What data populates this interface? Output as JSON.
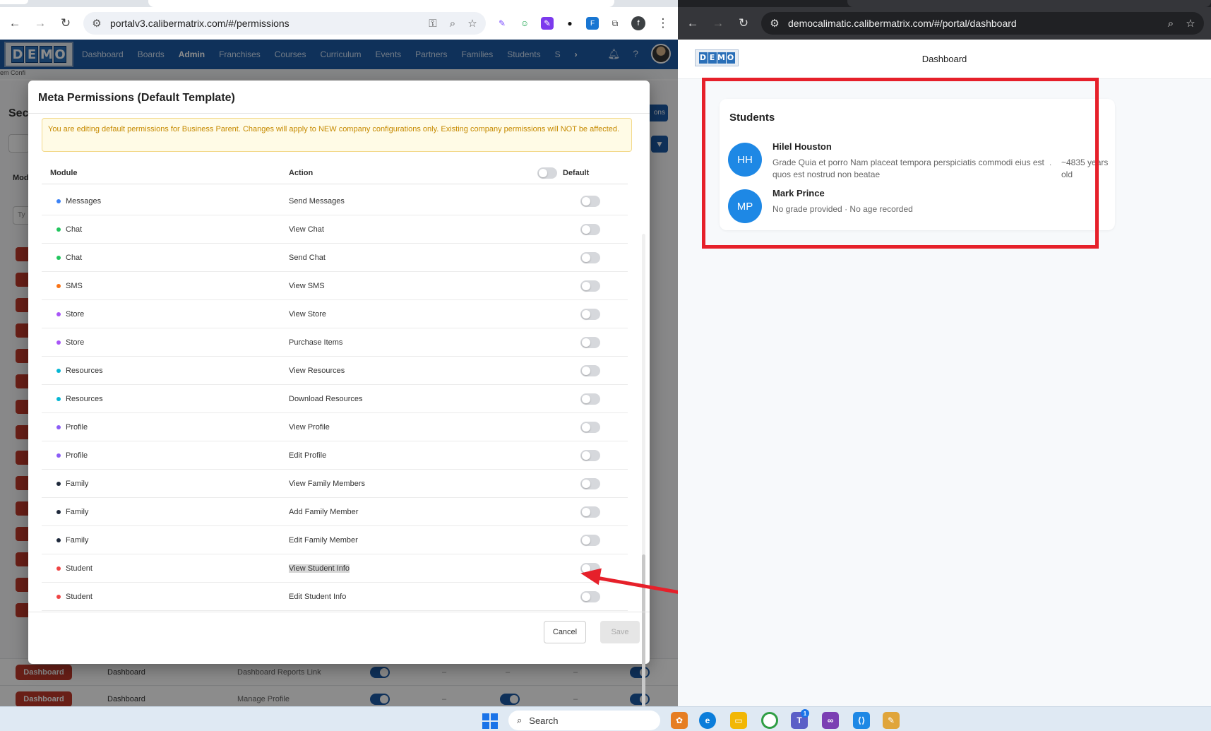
{
  "left_browser": {
    "url": "portalv3.calibermatrix.com/#/permissions",
    "profile_letter": "f",
    "logo_letters": [
      "D",
      "E",
      "M",
      "O"
    ],
    "nav_items": [
      "Dashboard",
      "Boards",
      "Admin",
      "Franchises",
      "Courses",
      "Curriculum",
      "Events",
      "Partners",
      "Families",
      "Students",
      "S"
    ],
    "breadcrumb_text": "em Confi"
  },
  "background_page": {
    "title": "Sec",
    "button_label": "ons",
    "module_header": "Mod",
    "filter_placeholder": "Ty",
    "rows": [
      {
        "badge": "Dashboard",
        "module": "Dashboard",
        "action": "Dashboard Reports Link"
      },
      {
        "badge": "Dashboard",
        "module": "Dashboard",
        "action": "Manage Profile"
      }
    ],
    "dash_symbol": "–"
  },
  "modal": {
    "title": "Meta Permissions (Default Template)",
    "warning": "You are editing default permissions for Business Parent. Changes will apply to NEW company configurations only. Existing company permissions will NOT be affected.",
    "col_module": "Module",
    "col_action": "Action",
    "col_default": "Default",
    "rows": [
      {
        "module": "Messages",
        "action": "Send Messages",
        "color": "#3b82f6"
      },
      {
        "module": "Chat",
        "action": "View Chat",
        "color": "#22c55e"
      },
      {
        "module": "Chat",
        "action": "Send Chat",
        "color": "#22c55e"
      },
      {
        "module": "SMS",
        "action": "View SMS",
        "color": "#f97316"
      },
      {
        "module": "Store",
        "action": "View Store",
        "color": "#a855f7"
      },
      {
        "module": "Store",
        "action": "Purchase Items",
        "color": "#a855f7"
      },
      {
        "module": "Resources",
        "action": "View Resources",
        "color": "#06b6d4"
      },
      {
        "module": "Resources",
        "action": "Download Resources",
        "color": "#06b6d4"
      },
      {
        "module": "Profile",
        "action": "View Profile",
        "color": "#8b5cf6"
      },
      {
        "module": "Profile",
        "action": "Edit Profile",
        "color": "#8b5cf6"
      },
      {
        "module": "Family",
        "action": "View Family Members",
        "color": "#1e293b"
      },
      {
        "module": "Family",
        "action": "Add Family Member",
        "color": "#1e293b"
      },
      {
        "module": "Family",
        "action": "Edit Family Member",
        "color": "#1e293b"
      },
      {
        "module": "Student",
        "action": "View Student Info",
        "color": "#ef4444"
      },
      {
        "module": "Student",
        "action": "Edit Student Info",
        "color": "#ef4444"
      }
    ],
    "cancel_label": "Cancel",
    "save_label": "Save"
  },
  "right_browser": {
    "url": "democalimatic.calibermatrix.com/#/portal/dashboard",
    "logo_letters": [
      "D",
      "E",
      "M",
      "O"
    ],
    "page_title": "Dashboard",
    "card_title": "Students",
    "students": [
      {
        "initials": "HH",
        "name": "Hilel Houston",
        "details": "Grade Quia et porro Nam placeat tempora perspiciatis commodi eius est quos est nostrud non beatae",
        "separator": "·",
        "age": "~4835 years old"
      },
      {
        "initials": "MP",
        "name": "Mark Prince",
        "details": "No grade provided",
        "separator": "·",
        "age": "No age recorded"
      }
    ]
  },
  "taskbar": {
    "search_label": "Search",
    "teams_badge": "1"
  }
}
